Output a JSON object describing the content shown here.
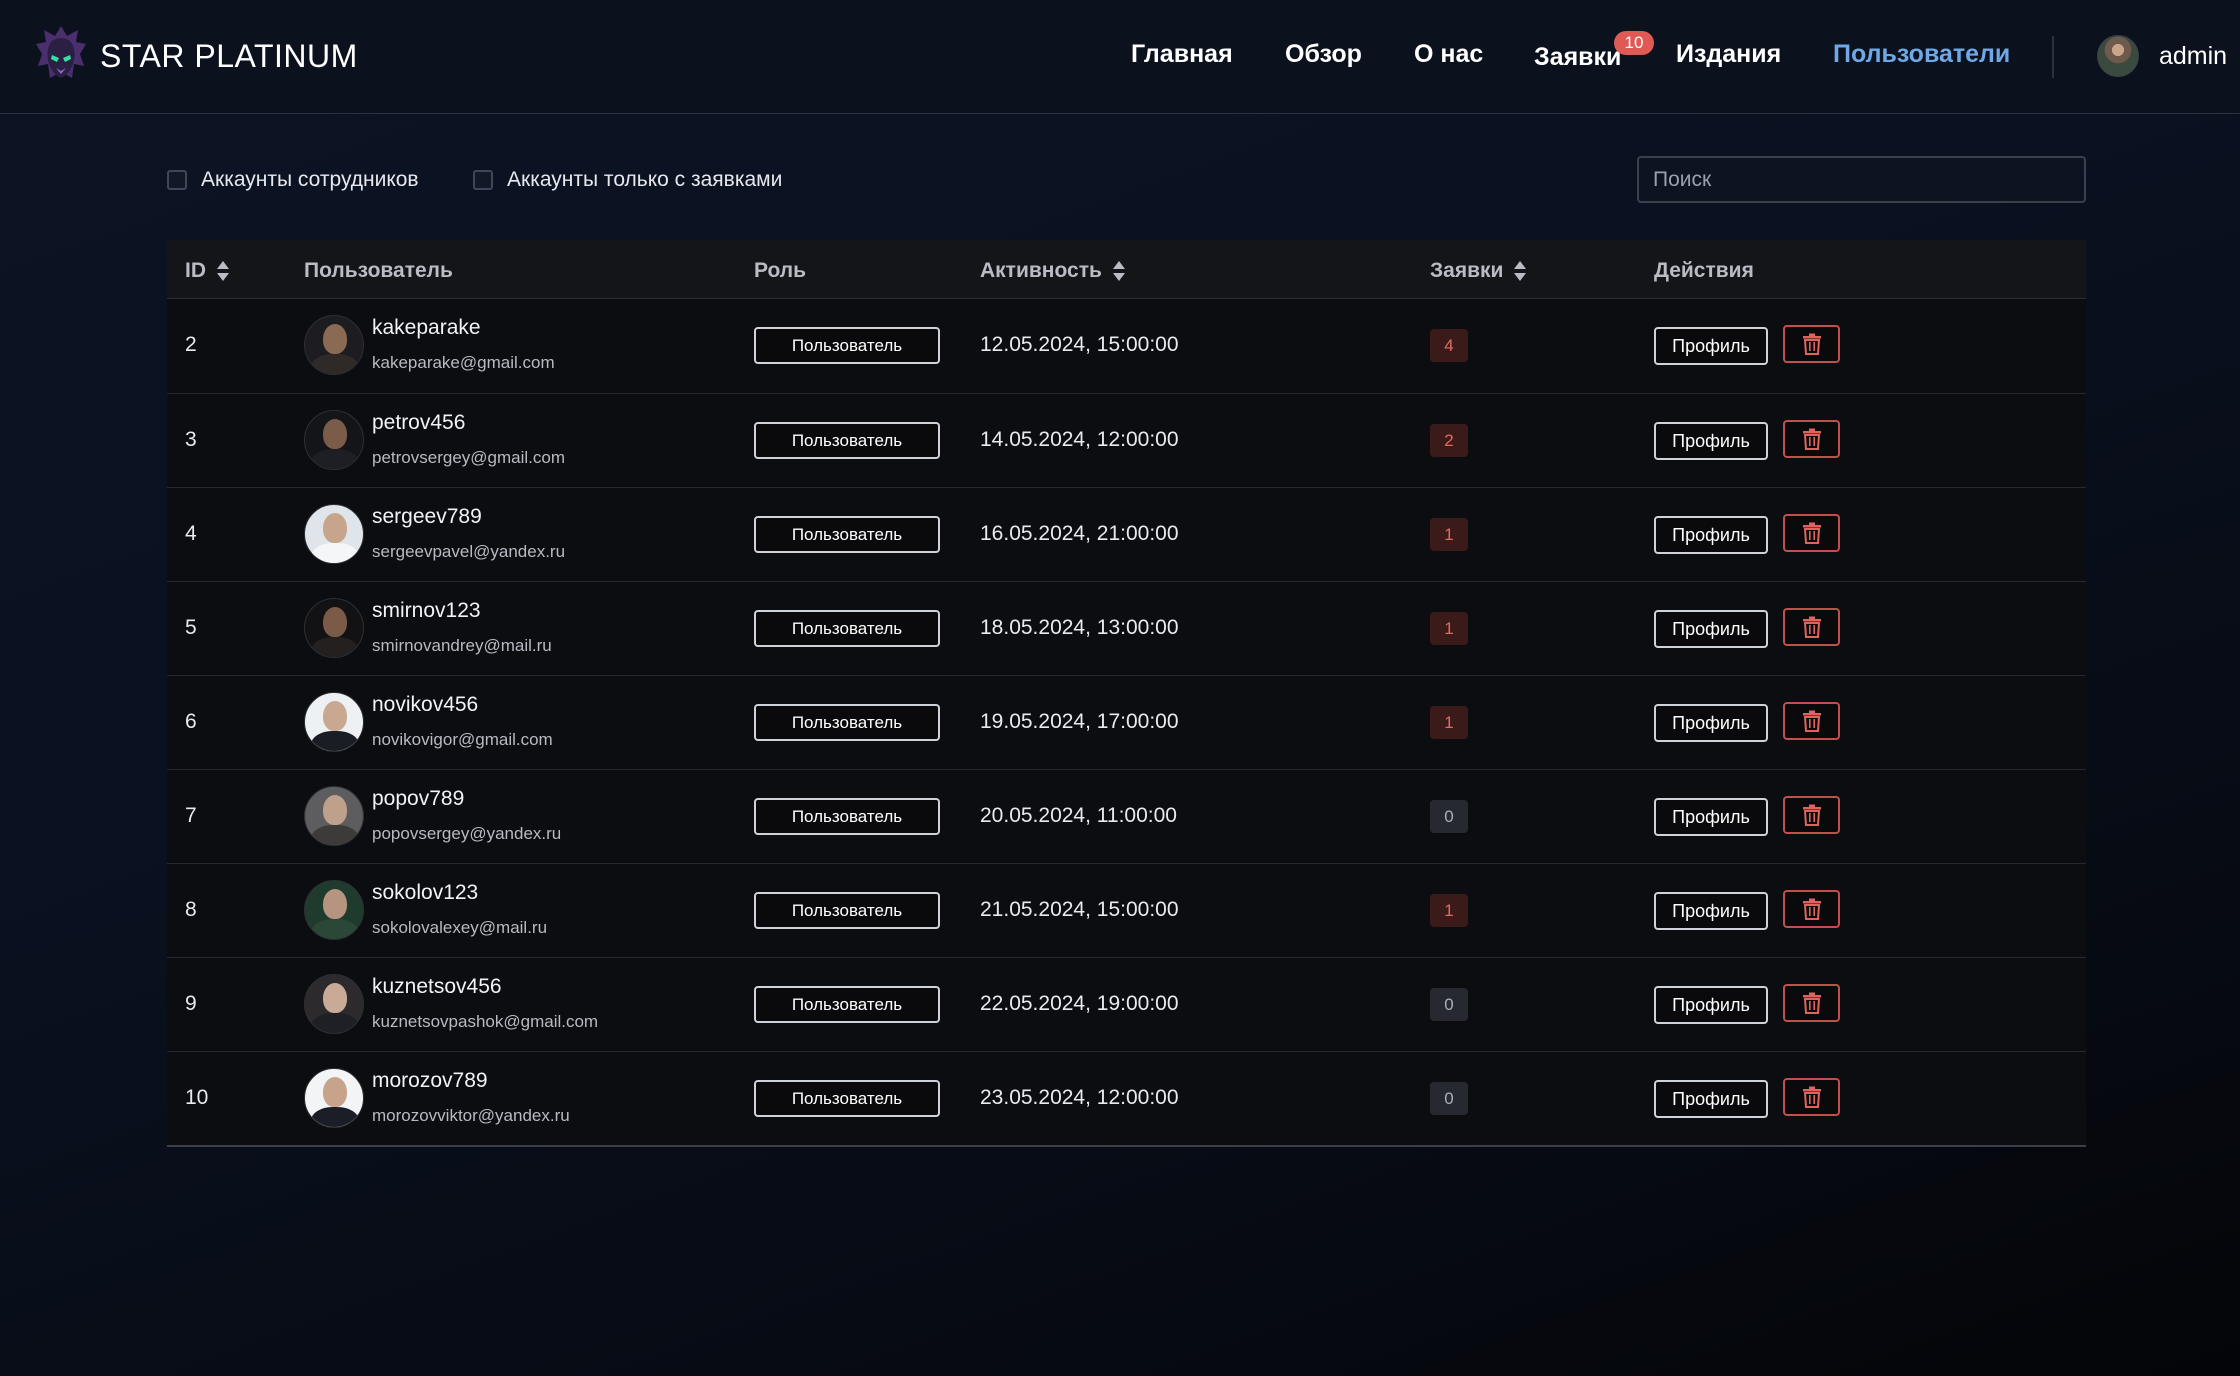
{
  "header": {
    "brand": "STAR PLATINUM",
    "nav": [
      {
        "label": "Главная",
        "active": false
      },
      {
        "label": "Обзор",
        "active": false
      },
      {
        "label": "О нас",
        "active": false
      },
      {
        "label": "Заявки",
        "active": false
      },
      {
        "label": "Издания",
        "active": false
      },
      {
        "label": "Пользователи",
        "active": true
      }
    ],
    "requests_badge": "10",
    "user_name": "admin"
  },
  "filters": {
    "staff_accounts": "Аккаунты сотрудников",
    "with_requests_only": "Аккаунты только с заявками",
    "search_placeholder": "Поиск",
    "search_value": ""
  },
  "table": {
    "columns": [
      "ID",
      "Пользователь",
      "Роль",
      "Активность",
      "Заявки",
      "Действия"
    ],
    "rows": [
      {
        "id": "2",
        "username": "kakeparake",
        "email": "kakeparake@gmail.com",
        "role": "Пользователь",
        "activity": "12.05.2024, 15:00:00",
        "requests": "4"
      },
      {
        "id": "3",
        "username": "petrov456",
        "email": "petrovsergey@gmail.com",
        "role": "Пользователь",
        "activity": "14.05.2024, 12:00:00",
        "requests": "2"
      },
      {
        "id": "4",
        "username": "sergeev789",
        "email": "sergeevpavel@yandex.ru",
        "role": "Пользователь",
        "activity": "16.05.2024, 21:00:00",
        "requests": "1"
      },
      {
        "id": "5",
        "username": "smirnov123",
        "email": "smirnovandrey@mail.ru",
        "role": "Пользователь",
        "activity": "18.05.2024, 13:00:00",
        "requests": "1"
      },
      {
        "id": "6",
        "username": "novikov456",
        "email": "novikovigor@gmail.com",
        "role": "Пользователь",
        "activity": "19.05.2024, 17:00:00",
        "requests": "1"
      },
      {
        "id": "7",
        "username": "popov789",
        "email": "popovsergey@yandex.ru",
        "role": "Пользователь",
        "activity": "20.05.2024, 11:00:00",
        "requests": "0"
      },
      {
        "id": "8",
        "username": "sokolov123",
        "email": "sokolovalexey@mail.ru",
        "role": "Пользователь",
        "activity": "21.05.2024, 15:00:00",
        "requests": "1"
      },
      {
        "id": "9",
        "username": "kuznetsov456",
        "email": "kuznetsovpashok@gmail.com",
        "role": "Пользователь",
        "activity": "22.05.2024, 19:00:00",
        "requests": "0"
      },
      {
        "id": "10",
        "username": "morozov789",
        "email": "morozovviktor@yandex.ru",
        "role": "Пользователь",
        "activity": "23.05.2024, 12:00:00",
        "requests": "0"
      }
    ],
    "profile_label": "Профиль",
    "delete_icon": "trash-icon"
  },
  "colors": {
    "accent": "#6ea8e6",
    "badge": "#e05a55",
    "danger": "#c0504b"
  }
}
